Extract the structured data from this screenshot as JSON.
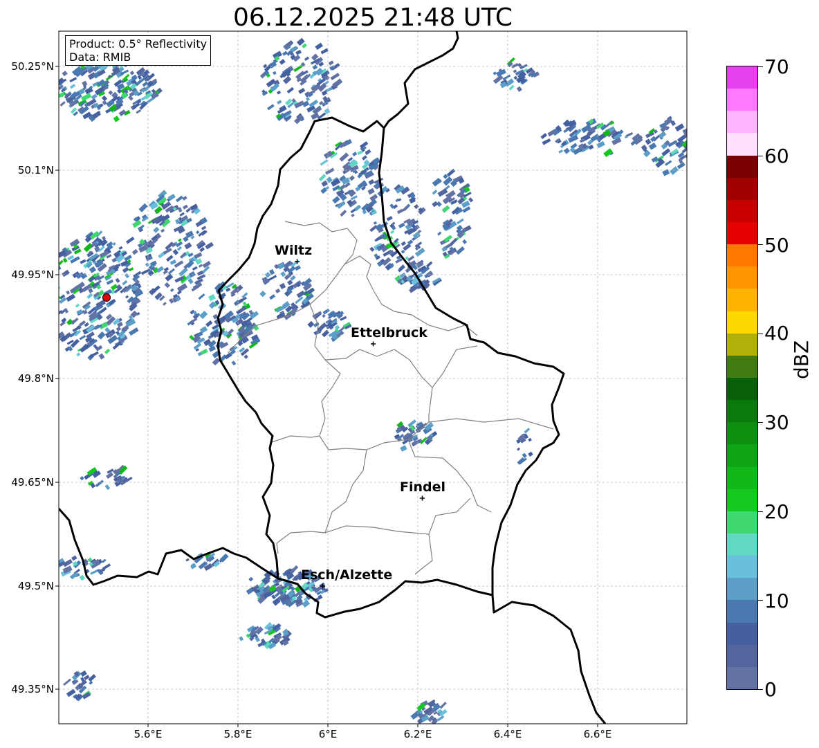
{
  "title": "06.12.2025 21:48 UTC",
  "product_box": {
    "product": "Product: 0.5° Reflectivity",
    "data": "Data: RMIB"
  },
  "latitude_labels": [
    "50.25°N",
    "50.1°N",
    "49.95°N",
    "49.8°N",
    "49.65°N",
    "49.5°N",
    "49.35°N"
  ],
  "longitude_labels": [
    "5.6°E",
    "5.8°E",
    "6°E",
    "6.2°E",
    "6.4°E",
    "6.6°E"
  ],
  "cities": [
    {
      "name": "Wiltz"
    },
    {
      "name": "Ettelbruck"
    },
    {
      "name": "Findel"
    },
    {
      "name": "Esch/Alzette"
    }
  ],
  "colorbar": {
    "label": "dBZ",
    "ticks": [
      "70",
      "60",
      "50",
      "40",
      "30",
      "20",
      "10",
      "0"
    ],
    "colors": [
      "#6272a4",
      "#52659f",
      "#4560a0",
      "#4a78b0",
      "#5b9ec8",
      "#68c0dc",
      "#60d8c4",
      "#3fd870",
      "#14c81e",
      "#12b81a",
      "#10a414",
      "#0e8f10",
      "#0a7a0e",
      "#075f08",
      "#417a10",
      "#b0b00a",
      "#ffd800",
      "#ffb400",
      "#ff9600",
      "#ff7800",
      "#e60000",
      "#c80000",
      "#a00000",
      "#780000",
      "#ffe0ff",
      "#ffb4ff",
      "#ff78ff",
      "#e642f0"
    ]
  },
  "radar_marker_color": "#e60000"
}
